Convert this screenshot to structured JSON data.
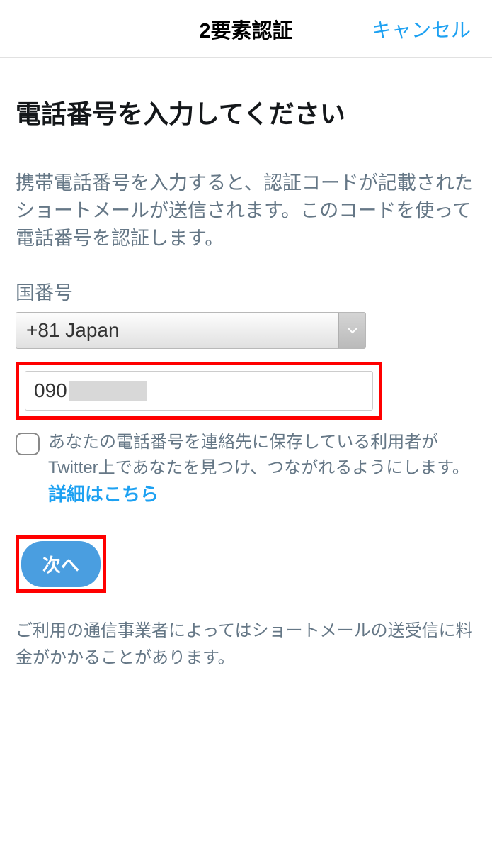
{
  "header": {
    "title": "2要素認証",
    "cancel": "キャンセル"
  },
  "main": {
    "page_title": "電話番号を入力してください",
    "description": "携帯電話番号を入力すると、認証コードが記載されたショートメールが送信されます。このコードを使って電話番号を認証します。",
    "country_label": "国番号",
    "country_value": "+81 Japan",
    "phone_value": "090",
    "checkbox_text": "あなたの電話番号を連絡先に保存している利用者がTwitter上であなたを見つけ、つながれるようにします。",
    "detail_link": "詳細はこちら",
    "next_button": "次へ",
    "footer_note": "ご利用の通信事業者によってはショートメールの送受信に料金がかかることがあります。"
  }
}
